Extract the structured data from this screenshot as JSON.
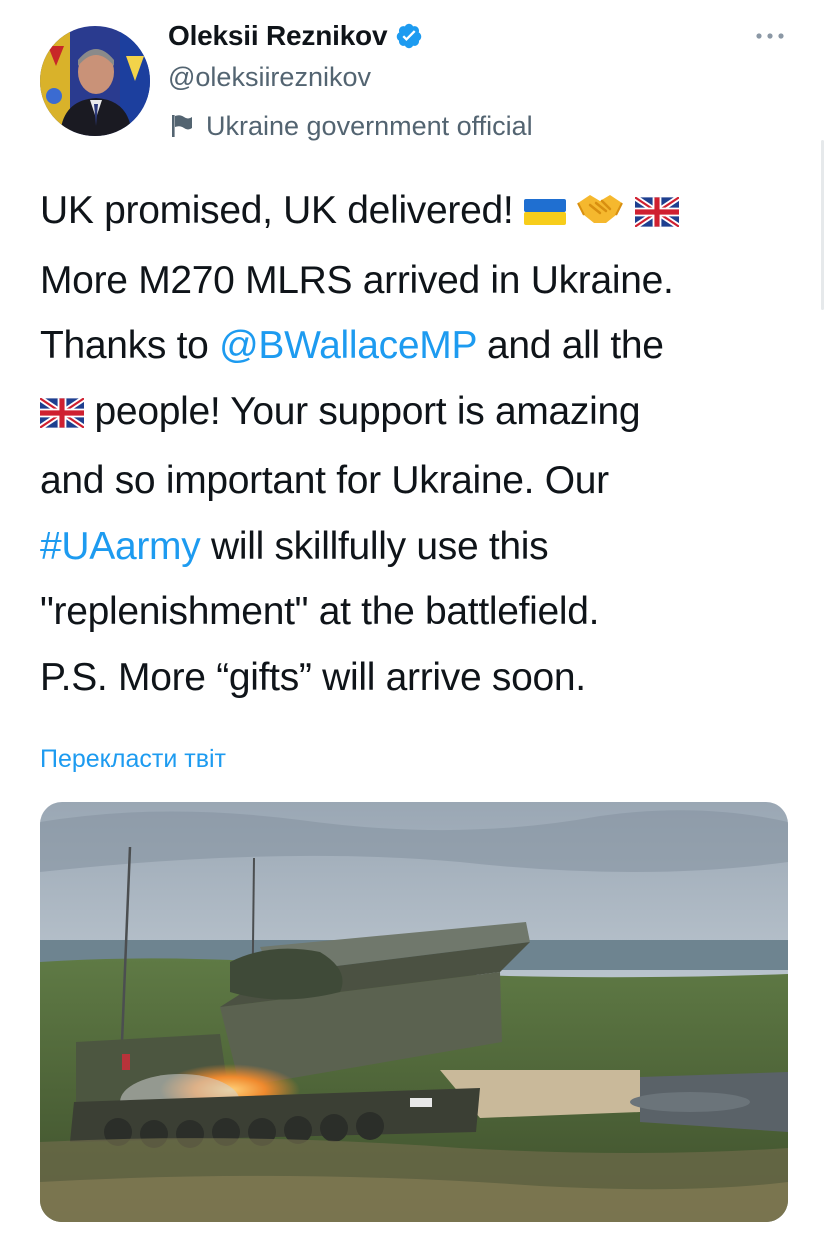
{
  "author": {
    "display_name": "Oleksii Reznikov",
    "handle": "@oleksiireznikov",
    "label": "Ukraine government official",
    "verified": true
  },
  "tweet": {
    "line1_text": "UK promised, UK delivered! ",
    "line2_text": "More M270 MLRS arrived in Ukraine.",
    "line3_prefix": "Thanks to ",
    "mention": "@BWallaceMP",
    "line3_suffix": " and all the",
    "line4_text": " people! Your support is amazing",
    "line5_text": "and so important for Ukraine. Our",
    "hashtag": "#UAarmy",
    "line6_suffix": " will skillfully use this",
    "line7_text": "\"replenishment\" at the battlefield.",
    "line8_text": "P.S. More “gifts” will arrive soon.",
    "emojis": [
      "ukraine-flag-icon",
      "handshake-icon",
      "uk-flag-icon"
    ]
  },
  "translate_label": "Перекласти твіт",
  "colors": {
    "link": "#1d9bf0",
    "secondary_text": "#536471",
    "primary_text": "#0f1419",
    "verified": "#1d9bf0"
  }
}
